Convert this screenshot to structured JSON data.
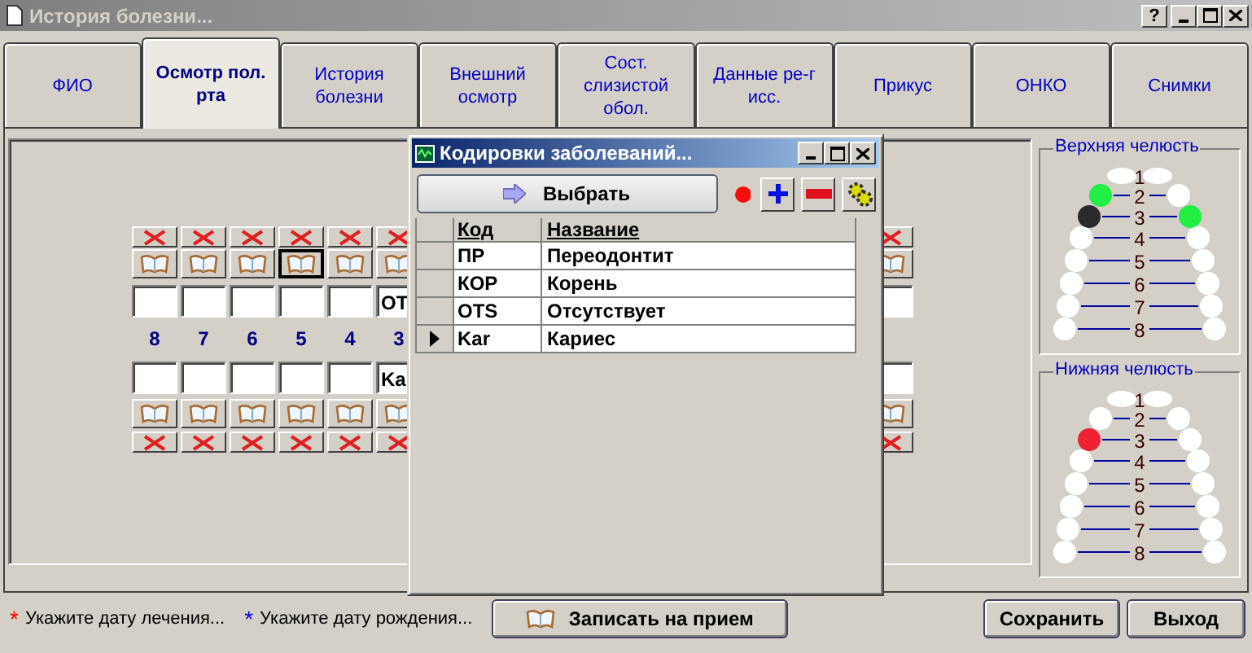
{
  "window": {
    "title": "История болезни...",
    "buttons": [
      {
        "kind": "help",
        "label": "?"
      },
      {
        "kind": "minimize"
      },
      {
        "kind": "maximize"
      },
      {
        "kind": "close"
      }
    ]
  },
  "tabs": [
    {
      "label": "ФИО",
      "selected": false
    },
    {
      "label": "Осмотр пол. рта",
      "selected": true
    },
    {
      "label": "История болезни",
      "selected": false
    },
    {
      "label": "Внешний осмотр",
      "selected": false
    },
    {
      "label": "Сост. слизистой обол.",
      "selected": false
    },
    {
      "label": "Данные ре-г исс.",
      "selected": false
    },
    {
      "label": "Прикус",
      "selected": false
    },
    {
      "label": "ОНКО",
      "selected": false
    },
    {
      "label": "Снимки",
      "selected": false
    }
  ],
  "grid": {
    "columns": [
      {
        "number": "8",
        "upper_book_focused": false
      },
      {
        "number": "7",
        "upper_book_focused": false
      },
      {
        "number": "6",
        "upper_book_focused": false
      },
      {
        "number": "5",
        "upper_book_focused": true
      },
      {
        "number": "4",
        "upper_book_focused": false
      },
      {
        "number": "3",
        "upper_value": "OT",
        "lower_value": "Ka",
        "upper_book_focused": false
      },
      {
        "upper_book_focused": false
      }
    ]
  },
  "dialog": {
    "title": "Кодировки заболеваний...",
    "select_button": "Выбрать",
    "columns": [
      "Код",
      "Название"
    ],
    "rows": [
      {
        "code": "ПР",
        "name": "Переодонтит",
        "selected": false
      },
      {
        "code": "КОР",
        "name": "Корень",
        "selected": false
      },
      {
        "code": "OTS",
        "name": "Отсутствует",
        "selected": false
      },
      {
        "code": "Kar",
        "name": "Кариес",
        "selected": true
      }
    ]
  },
  "jaws": [
    {
      "title": "Верхняя челюсть",
      "rows": [
        {
          "label": "1",
          "teeth": [
            {
              "color": "#ffffff"
            },
            {
              "color": "#ffffff"
            }
          ]
        },
        {
          "label": "2",
          "teeth": [
            {
              "color": "#22ee44"
            },
            {
              "color": "#ffffff"
            }
          ]
        },
        {
          "label": "3",
          "teeth": [
            {
              "color": "#2a2a2a"
            },
            {
              "color": "#22ee44"
            }
          ]
        },
        {
          "label": "4",
          "teeth": [
            {
              "color": "#ffffff"
            },
            {
              "color": "#ffffff"
            }
          ]
        },
        {
          "label": "5",
          "teeth": [
            {
              "color": "#ffffff"
            },
            {
              "color": "#ffffff"
            }
          ]
        },
        {
          "label": "6",
          "teeth": [
            {
              "color": "#ffffff"
            },
            {
              "color": "#ffffff"
            }
          ]
        },
        {
          "label": "7",
          "teeth": [
            {
              "color": "#ffffff"
            },
            {
              "color": "#ffffff"
            }
          ]
        },
        {
          "label": "8",
          "teeth": [
            {
              "color": "#ffffff"
            },
            {
              "color": "#ffffff"
            }
          ]
        }
      ]
    },
    {
      "title": "Нижняя челюсть",
      "rows": [
        {
          "label": "1",
          "teeth": [
            {
              "color": "#ffffff"
            },
            {
              "color": "#ffffff"
            }
          ]
        },
        {
          "label": "2",
          "teeth": [
            {
              "color": "#ffffff"
            },
            {
              "color": "#ffffff"
            }
          ]
        },
        {
          "label": "3",
          "teeth": [
            {
              "color": "#ee2233"
            },
            {
              "color": "#ffffff"
            }
          ]
        },
        {
          "label": "4",
          "teeth": [
            {
              "color": "#ffffff"
            },
            {
              "color": "#ffffff"
            }
          ]
        },
        {
          "label": "5",
          "teeth": [
            {
              "color": "#ffffff"
            },
            {
              "color": "#ffffff"
            }
          ]
        },
        {
          "label": "6",
          "teeth": [
            {
              "color": "#ffffff"
            },
            {
              "color": "#ffffff"
            }
          ]
        },
        {
          "label": "7",
          "teeth": [
            {
              "color": "#ffffff"
            },
            {
              "color": "#ffffff"
            }
          ]
        },
        {
          "label": "8",
          "teeth": [
            {
              "color": "#ffffff"
            },
            {
              "color": "#ffffff"
            }
          ]
        }
      ]
    }
  ],
  "footer": {
    "hints": [
      {
        "mark": "*",
        "color": "#ee0000",
        "text": "Укажите дату лечения..."
      },
      {
        "mark": "*",
        "color": "#0000ee",
        "text": "Укажите дату рождения..."
      }
    ],
    "appointment_button": "Записать на прием",
    "save_button": "Сохранить",
    "exit_button": "Выход"
  }
}
